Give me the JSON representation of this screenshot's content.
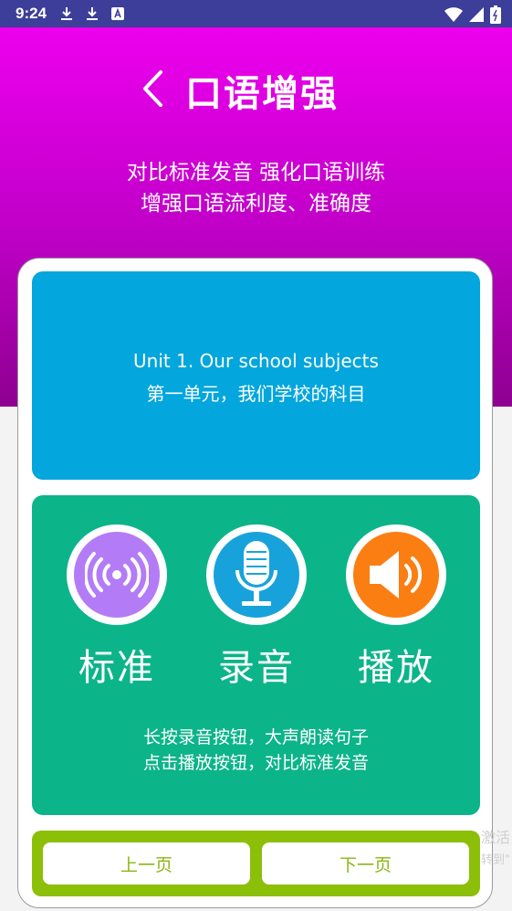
{
  "status_bar": {
    "time": "9:24",
    "left_icons": [
      "download-icon",
      "download-icon",
      "app-notification-icon"
    ],
    "right_icons": [
      "wifi-icon",
      "signal-icon",
      "battery-icon"
    ]
  },
  "header": {
    "back_icon": "chevron-left-icon",
    "title": "口语增强",
    "subtitle_line1": "对比标准发音  强化口语训练",
    "subtitle_line2": "增强口语流利度、准确度"
  },
  "unit": {
    "title_en": "Unit 1. Our school subjects",
    "title_zh": "第一单元，我们学校的科目"
  },
  "practice": {
    "modes": [
      {
        "label": "标准",
        "icon": "sound-wave-icon",
        "color": "#b37cf6"
      },
      {
        "label": "录音",
        "icon": "microphone-icon",
        "color": "#18a2dc"
      },
      {
        "label": "播放",
        "icon": "speaker-icon",
        "color": "#fb7e12"
      }
    ],
    "hint_line1": "长按录音按钮，大声朗读句子",
    "hint_line2": "点击播放按钮，对比标准发音"
  },
  "navigation": {
    "prev_label": "上一页",
    "next_label": "下一页"
  },
  "overlay": {
    "line1": "激活",
    "line2": "转到\""
  },
  "colors": {
    "status_bar": "#3d3d9a",
    "header_gradient_top": "#f300f3",
    "unit_panel": "#03a6dd",
    "practice_panel": "#0cb48a",
    "nav_bar": "#8cbf08"
  }
}
